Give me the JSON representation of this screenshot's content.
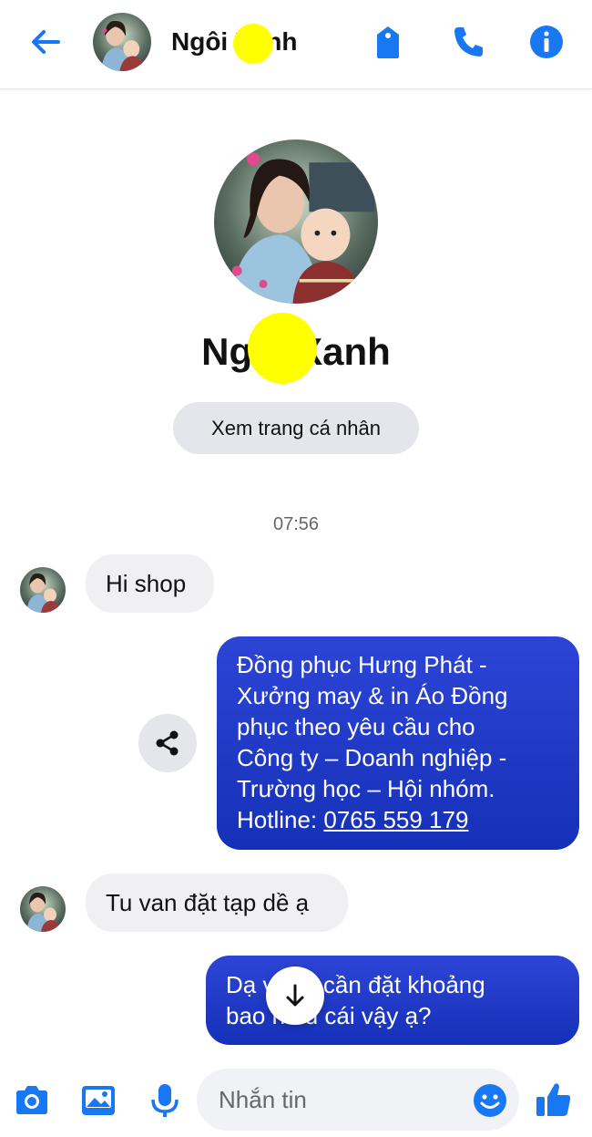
{
  "header": {
    "contact_name": "Ngôi     Xanh",
    "back_icon": "back-arrow-icon",
    "icons": [
      "tag-icon",
      "phone-icon",
      "info-icon"
    ],
    "accent": "#1877f2"
  },
  "profile": {
    "name": "Ngôi     Xanh",
    "view_profile_label": "Xem trang cá nhân"
  },
  "conversation": {
    "timestamp": "07:56",
    "messages": [
      {
        "from": "contact",
        "text": "Hi shop"
      },
      {
        "from": "me",
        "lines": [
          "Đồng phục Hưng Phát -",
          "Xưởng may & in Áo Đồng",
          "phục theo yêu cầu cho",
          "Công ty – Doanh nghiệp -",
          "Trường học – Hội nhóm."
        ],
        "hotline_label": "Hotline: ",
        "hotline_number": "0765 559 179"
      },
      {
        "from": "contact",
        "text": "Tu van đặt tạp dề ạ"
      },
      {
        "from": "me",
        "lines": [
          "Dạ v     Chị cần đặt khoảng",
          "bao n   ều cái vậy ạ?"
        ]
      }
    ]
  },
  "composer": {
    "placeholder": "Nhắn tin",
    "icons": [
      "camera-icon",
      "image-icon",
      "microphone-icon",
      "emoji-icon",
      "thumbs-up-icon"
    ]
  },
  "colors": {
    "outgoing_bubble": "#1a35c4",
    "incoming_bubble": "#f0f0f3",
    "icon_blue": "#1877f2",
    "redaction_mask": "#ffff00"
  }
}
